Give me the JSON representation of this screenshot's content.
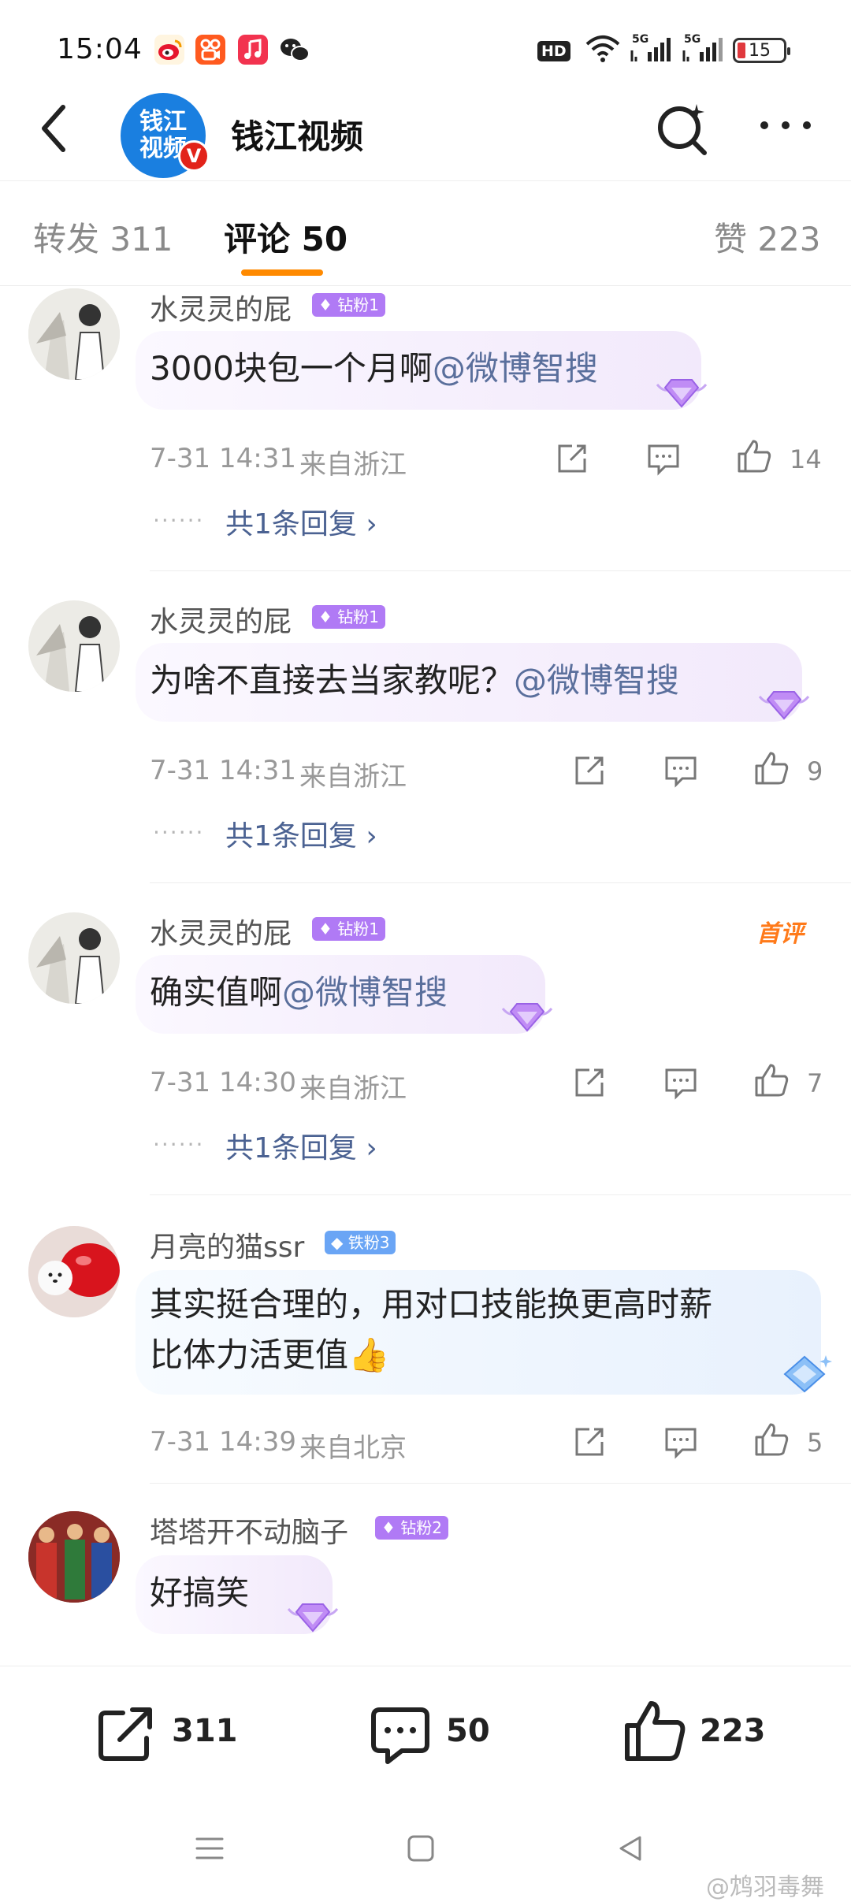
{
  "status_bar": {
    "time": "15:04",
    "app_icons": [
      "weibo-icon",
      "kuaishou-icon",
      "music-icon",
      "wechat-icon"
    ],
    "hd_label": "HD",
    "network_1": "5G",
    "network_2": "5G",
    "battery": "15"
  },
  "header": {
    "title": "钱江视频",
    "avatar_text_line1": "钱江",
    "avatar_text_line2": "视频",
    "verified_label": "V"
  },
  "tabs": [
    {
      "label": "转发 311"
    },
    {
      "label": "评论 50"
    },
    {
      "label": "赞 223"
    }
  ],
  "comments": [
    {
      "username": "水灵灵的屁",
      "fan_badge": "钻粉1",
      "text": "3000块包一个月啊",
      "mention": "@微博智搜",
      "time": "7-31 14:31",
      "location": "来自浙江",
      "likes": "14",
      "reply_link": "共1条回复 ›"
    },
    {
      "username": "水灵灵的屁",
      "fan_badge": "钻粉1",
      "text": "为啥不直接去当家教呢？",
      "mention": "@微博智搜",
      "time": "7-31 14:31",
      "location": "来自浙江",
      "likes": "9",
      "reply_link": "共1条回复 ›"
    },
    {
      "username": "水灵灵的屁",
      "fan_badge": "钻粉1",
      "first_comment_tag": "首评",
      "text": "确实值啊",
      "mention": "@微博智搜",
      "time": "7-31 14:30",
      "location": "来自浙江",
      "likes": "7",
      "reply_link": "共1条回复 ›"
    },
    {
      "username": "月亮的猫ssr",
      "fan_badge": "铁粉3",
      "text_line1": "其实挺合理的，用对口技能换更高时薪",
      "text_line2": "比体力活更值👍",
      "time": "7-31 14:39",
      "location": "来自北京",
      "likes": "5"
    },
    {
      "username": "塔塔开不动脑子",
      "fan_badge": "钻粉2",
      "text": "好搞笑"
    }
  ],
  "bottom_bar": {
    "repost_count": "311",
    "comment_count": "50",
    "like_count": "223"
  },
  "watermark": "@鸩羽毒舞",
  "colors": {
    "accent": "#ff8a00",
    "mention": "#5a6f9c",
    "diamond_purple": "#b07af5",
    "iron_blue": "#6aa5f5"
  }
}
